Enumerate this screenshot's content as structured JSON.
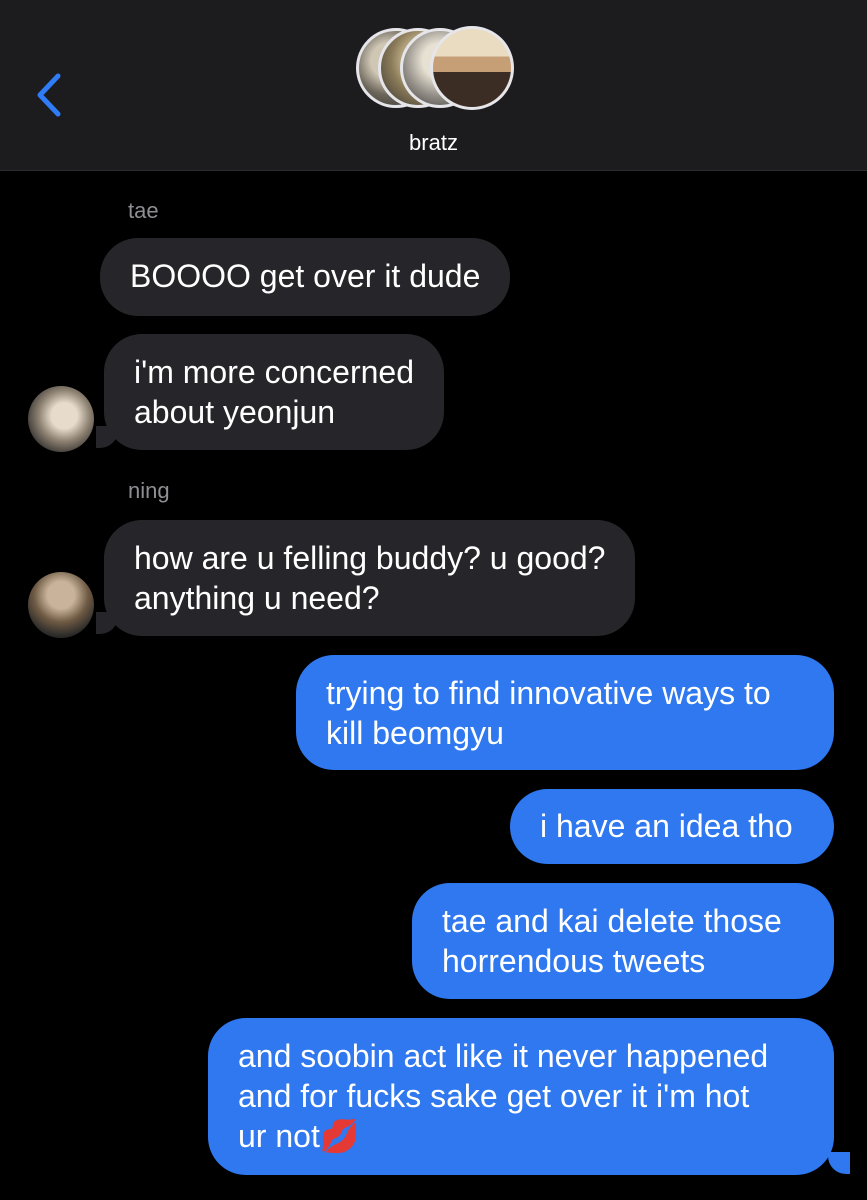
{
  "header": {
    "back_icon": "chevron-left-icon",
    "group_name": "bratz"
  },
  "messages": [
    {
      "sender": "tae",
      "direction": "incoming",
      "lines": [
        "BOOOO get over it dude"
      ]
    },
    {
      "direction": "incoming",
      "lines": [
        "i'm more concerned",
        "about yeonjun"
      ]
    },
    {
      "sender": "ning",
      "direction": "incoming",
      "lines": [
        "how are u felling buddy? u good?",
        "anything u need?"
      ]
    },
    {
      "direction": "outgoing",
      "lines": [
        "trying to find innovative ways to",
        "kill beomgyu"
      ]
    },
    {
      "direction": "outgoing",
      "lines": [
        "i have an idea tho"
      ]
    },
    {
      "direction": "outgoing",
      "lines": [
        "tae and kai delete those",
        "horrendous tweets"
      ]
    },
    {
      "direction": "outgoing",
      "lines": [
        "and soobin act like it never happened",
        "and for fucks sake get over it i'm hot",
        "ur not💋"
      ]
    }
  ],
  "colors": {
    "incoming_bubble": "#26262a",
    "outgoing_bubble": "#2f78ef",
    "accent": "#2f7cf6"
  }
}
